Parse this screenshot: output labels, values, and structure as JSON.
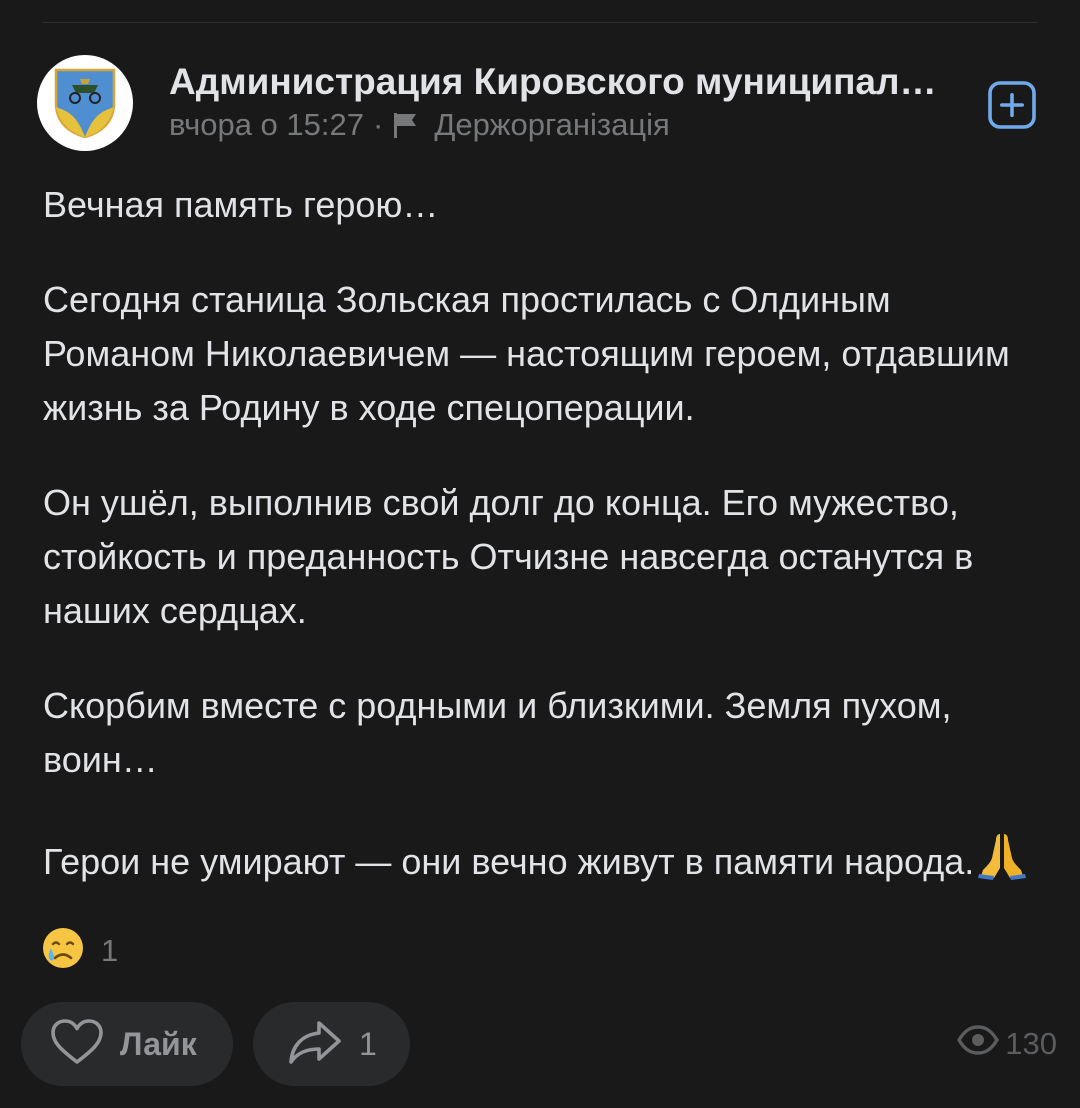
{
  "post": {
    "author": "Администрация Кировского муниципального округа",
    "meta": {
      "time": "вчора о 15:27",
      "separator": "·",
      "category": "Держорганізація"
    },
    "icons": {
      "avatar": "coat-of-arms-icon",
      "subscribe": "plus-square-icon",
      "category": "flag-icon",
      "reaction": "crying-face-icon",
      "like": "heart-icon",
      "share": "share-arrow-icon",
      "views": "eye-icon"
    },
    "paragraphs": [
      "Вечная память герою…",
      "Сегодня станица Зольская простилась с Олдиным Романом Николаевичем — настоящим героем, отдавшим жизнь за Родину в ходе спецоперации.",
      "Он ушёл, выполнив свой долг до конца. Его мужество, стойкость и преданность Отчизне навсегда останутся в наших сердцах.",
      "Скорбим вместе с родными и близкими. Земля пухом, воин…",
      "Герои не умирают — они вечно живут в памяти народа."
    ],
    "reactions": {
      "count": "1"
    },
    "actions": {
      "like_label": "Лайк",
      "share_count": "1"
    },
    "views": "130"
  },
  "colors": {
    "background": "#19191a",
    "text": "#e1e3e6",
    "secondary_text": "#76787a",
    "accent": "#71aaeb",
    "button_bg": "#292a2b"
  }
}
